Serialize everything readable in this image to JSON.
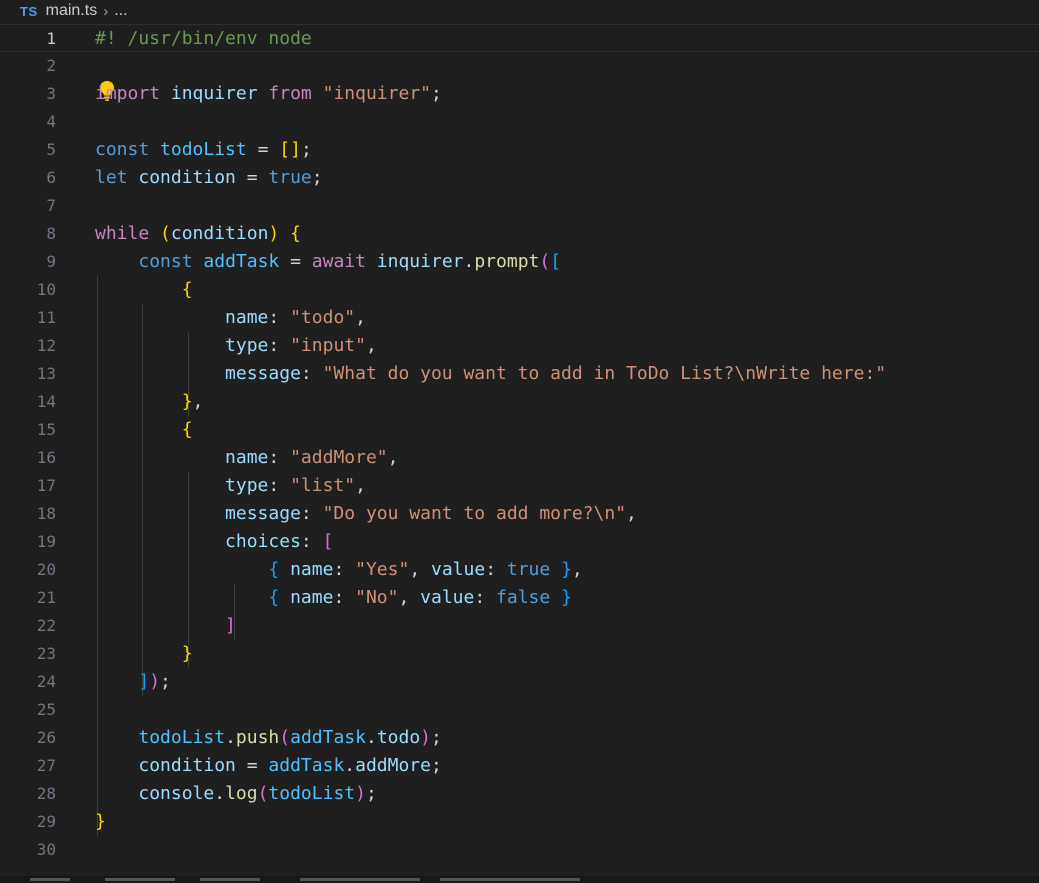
{
  "breadcrumb": {
    "lang_badge": "TS",
    "file": "main.ts",
    "separator": "›",
    "more": "..."
  },
  "editor": {
    "active_line": 1,
    "lines": [
      {
        "n": "1",
        "tokens": [
          [
            "#! /usr/bin/env node",
            "cm"
          ]
        ]
      },
      {
        "n": "2",
        "tokens": []
      },
      {
        "n": "3",
        "tokens": [
          [
            "import",
            "kw"
          ],
          [
            " ",
            "pl"
          ],
          [
            "inquirer",
            "va"
          ],
          [
            " ",
            "pl"
          ],
          [
            "from",
            "kw"
          ],
          [
            " ",
            "pl"
          ],
          [
            "\"inquirer\"",
            "st"
          ],
          [
            ";",
            "pl"
          ]
        ]
      },
      {
        "n": "4",
        "tokens": []
      },
      {
        "n": "5",
        "tokens": [
          [
            "const",
            "sk"
          ],
          [
            " ",
            "pl"
          ],
          [
            "todoList",
            "vc"
          ],
          [
            " = ",
            "pl"
          ],
          [
            "[]",
            "b1"
          ],
          [
            ";",
            "pl"
          ]
        ]
      },
      {
        "n": "6",
        "tokens": [
          [
            "let",
            "sk"
          ],
          [
            " ",
            "pl"
          ],
          [
            "condition",
            "va"
          ],
          [
            " = ",
            "pl"
          ],
          [
            "true",
            "sk"
          ],
          [
            ";",
            "pl"
          ]
        ]
      },
      {
        "n": "7",
        "tokens": []
      },
      {
        "n": "8",
        "tokens": [
          [
            "while",
            "kw"
          ],
          [
            " ",
            "pl"
          ],
          [
            "(",
            "b1"
          ],
          [
            "condition",
            "va"
          ],
          [
            ")",
            "b1"
          ],
          [
            " ",
            "pl"
          ],
          [
            "{",
            "b1"
          ]
        ]
      },
      {
        "n": "9",
        "tokens": [
          [
            "    ",
            "pl"
          ],
          [
            "const",
            "sk"
          ],
          [
            " ",
            "pl"
          ],
          [
            "addTask",
            "vc"
          ],
          [
            " = ",
            "pl"
          ],
          [
            "await",
            "kw"
          ],
          [
            " ",
            "pl"
          ],
          [
            "inquirer",
            "va"
          ],
          [
            ".",
            "pl"
          ],
          [
            "prompt",
            "fn"
          ],
          [
            "(",
            "b2"
          ],
          [
            "[",
            "b3"
          ]
        ]
      },
      {
        "n": "10",
        "tokens": [
          [
            "        ",
            "pl"
          ],
          [
            "{",
            "b1"
          ]
        ]
      },
      {
        "n": "11",
        "tokens": [
          [
            "            ",
            "pl"
          ],
          [
            "name",
            "va"
          ],
          [
            ": ",
            "pl"
          ],
          [
            "\"todo\"",
            "st"
          ],
          [
            ",",
            "pl"
          ]
        ]
      },
      {
        "n": "12",
        "tokens": [
          [
            "            ",
            "pl"
          ],
          [
            "type",
            "va"
          ],
          [
            ": ",
            "pl"
          ],
          [
            "\"input\"",
            "st"
          ],
          [
            ",",
            "pl"
          ]
        ]
      },
      {
        "n": "13",
        "tokens": [
          [
            "            ",
            "pl"
          ],
          [
            "message",
            "va"
          ],
          [
            ": ",
            "pl"
          ],
          [
            "\"What do you want to add in ToDo List?\\nWrite here:\"",
            "st"
          ]
        ]
      },
      {
        "n": "14",
        "tokens": [
          [
            "        ",
            "pl"
          ],
          [
            "}",
            "b1"
          ],
          [
            ",",
            "pl"
          ]
        ]
      },
      {
        "n": "15",
        "tokens": [
          [
            "        ",
            "pl"
          ],
          [
            "{",
            "b1"
          ]
        ]
      },
      {
        "n": "16",
        "tokens": [
          [
            "            ",
            "pl"
          ],
          [
            "name",
            "va"
          ],
          [
            ": ",
            "pl"
          ],
          [
            "\"addMore\"",
            "st"
          ],
          [
            ",",
            "pl"
          ]
        ]
      },
      {
        "n": "17",
        "tokens": [
          [
            "            ",
            "pl"
          ],
          [
            "type",
            "va"
          ],
          [
            ": ",
            "pl"
          ],
          [
            "\"list\"",
            "st"
          ],
          [
            ",",
            "pl"
          ]
        ]
      },
      {
        "n": "18",
        "tokens": [
          [
            "            ",
            "pl"
          ],
          [
            "message",
            "va"
          ],
          [
            ": ",
            "pl"
          ],
          [
            "\"Do you want to add more?\\n\"",
            "st"
          ],
          [
            ",",
            "pl"
          ]
        ]
      },
      {
        "n": "19",
        "tokens": [
          [
            "            ",
            "pl"
          ],
          [
            "choices",
            "va"
          ],
          [
            ": ",
            "pl"
          ],
          [
            "[",
            "b2"
          ]
        ]
      },
      {
        "n": "20",
        "tokens": [
          [
            "                ",
            "pl"
          ],
          [
            "{",
            "b3"
          ],
          [
            " ",
            "pl"
          ],
          [
            "name",
            "va"
          ],
          [
            ": ",
            "pl"
          ],
          [
            "\"Yes\"",
            "st"
          ],
          [
            ", ",
            "pl"
          ],
          [
            "value",
            "va"
          ],
          [
            ": ",
            "pl"
          ],
          [
            "true",
            "sk"
          ],
          [
            " ",
            "pl"
          ],
          [
            "}",
            "b3"
          ],
          [
            ",",
            "pl"
          ]
        ]
      },
      {
        "n": "21",
        "tokens": [
          [
            "                ",
            "pl"
          ],
          [
            "{",
            "b3"
          ],
          [
            " ",
            "pl"
          ],
          [
            "name",
            "va"
          ],
          [
            ": ",
            "pl"
          ],
          [
            "\"No\"",
            "st"
          ],
          [
            ", ",
            "pl"
          ],
          [
            "value",
            "va"
          ],
          [
            ": ",
            "pl"
          ],
          [
            "false",
            "sk"
          ],
          [
            " ",
            "pl"
          ],
          [
            "}",
            "b3"
          ]
        ]
      },
      {
        "n": "22",
        "tokens": [
          [
            "            ",
            "pl"
          ],
          [
            "]",
            "b2"
          ]
        ]
      },
      {
        "n": "23",
        "tokens": [
          [
            "        ",
            "pl"
          ],
          [
            "}",
            "b1"
          ]
        ]
      },
      {
        "n": "24",
        "tokens": [
          [
            "    ",
            "pl"
          ],
          [
            "]",
            "b3"
          ],
          [
            ")",
            "b2"
          ],
          [
            ";",
            "pl"
          ]
        ]
      },
      {
        "n": "25",
        "tokens": []
      },
      {
        "n": "26",
        "tokens": [
          [
            "    ",
            "pl"
          ],
          [
            "todoList",
            "vc"
          ],
          [
            ".",
            "pl"
          ],
          [
            "push",
            "fn"
          ],
          [
            "(",
            "b2"
          ],
          [
            "addTask",
            "vc"
          ],
          [
            ".",
            "pl"
          ],
          [
            "todo",
            "va"
          ],
          [
            ")",
            "b2"
          ],
          [
            ";",
            "pl"
          ]
        ]
      },
      {
        "n": "27",
        "tokens": [
          [
            "    ",
            "pl"
          ],
          [
            "condition",
            "va"
          ],
          [
            " = ",
            "pl"
          ],
          [
            "addTask",
            "vc"
          ],
          [
            ".",
            "pl"
          ],
          [
            "addMore",
            "va"
          ],
          [
            ";",
            "pl"
          ]
        ]
      },
      {
        "n": "28",
        "tokens": [
          [
            "    ",
            "pl"
          ],
          [
            "console",
            "va"
          ],
          [
            ".",
            "pl"
          ],
          [
            "log",
            "fn"
          ],
          [
            "(",
            "b2"
          ],
          [
            "todoList",
            "vc"
          ],
          [
            ")",
            "b2"
          ],
          [
            ";",
            "pl"
          ]
        ]
      },
      {
        "n": "29",
        "tokens": [
          [
            "}",
            "b1"
          ]
        ]
      },
      {
        "n": "30",
        "tokens": []
      }
    ]
  },
  "colors": {
    "background": "#1f1f1f",
    "comment": "#6a9955",
    "keyword": "#c586c0",
    "string": "#ce9178",
    "storage": "#569cd6",
    "variable": "#9cdcfe",
    "const_variable": "#4fc1ff",
    "function": "#dcdcaa",
    "bracket_1": "#ffd700",
    "bracket_2": "#da70d6",
    "bracket_3": "#179fff",
    "lightbulb": "#ffcc00"
  },
  "icons": {
    "lightbulb": "lightbulb-icon"
  }
}
